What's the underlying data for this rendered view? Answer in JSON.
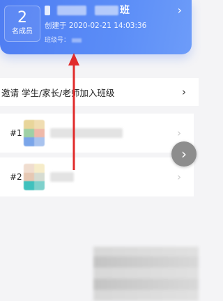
{
  "class_card": {
    "member_count": "2",
    "member_count_label": "名成员",
    "class_name_suffix": "班",
    "created_text": "创建于 2020-02-21 14:03:36",
    "class_code_label": "班级号：",
    "chevron": "›"
  },
  "invite": {
    "text": "邀请 学生/家长/老师加入班级",
    "chevron": "›"
  },
  "members": [
    {
      "index": "#1",
      "chevron": "›"
    },
    {
      "index": "#2",
      "chevron": "›"
    }
  ],
  "float_button": {
    "icon": "chevron-right-icon",
    "glyph": "›"
  },
  "colors": {
    "card_gradient_start": "#4f7df2",
    "card_gradient_end": "#6d9cf9",
    "annotation_arrow": "#e12b2b"
  }
}
